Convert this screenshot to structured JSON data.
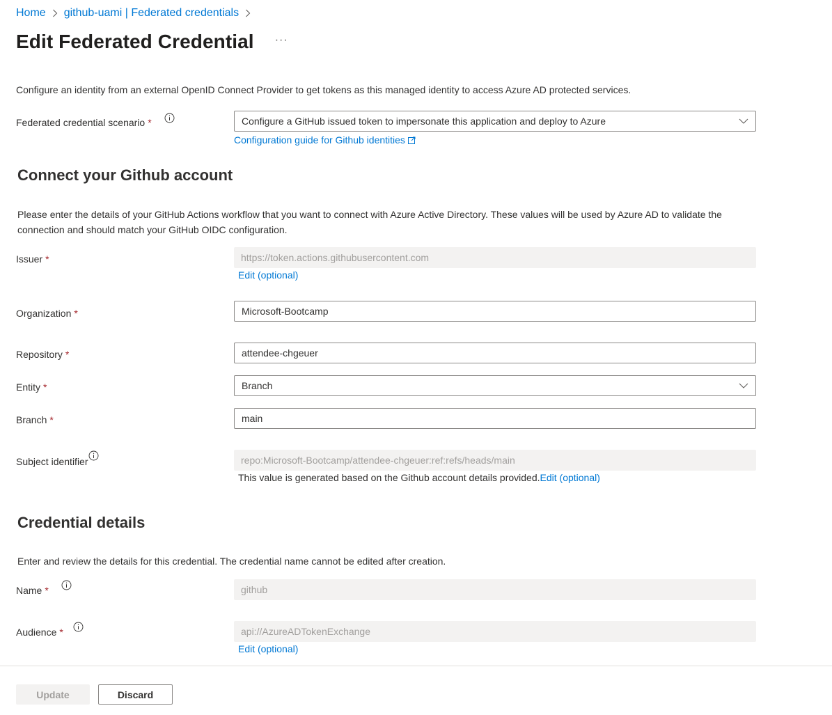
{
  "breadcrumb": {
    "items": [
      {
        "label": "Home"
      },
      {
        "label": "github-uami | Federated credentials"
      }
    ]
  },
  "header": {
    "title": "Edit Federated Credential",
    "more_label": "···"
  },
  "intro": "Configure an identity from an external OpenID Connect Provider to get tokens as this managed identity to access Azure AD protected services.",
  "scenario": {
    "label": "Federated credential scenario",
    "required": "*",
    "value": "Configure a GitHub issued token to impersonate this application and deploy to Azure",
    "guide_link": "Configuration guide for Github identities"
  },
  "github_section": {
    "title": "Connect your Github account",
    "description": "Please enter the details of your GitHub Actions workflow that you want to connect with Azure Active Directory. These values will be used by Azure AD to validate the connection and should match your GitHub OIDC configuration.",
    "issuer": {
      "label": "Issuer",
      "required": "*",
      "value": "https://token.actions.githubusercontent.com",
      "edit_link": "Edit (optional)"
    },
    "organization": {
      "label": "Organization",
      "required": "*",
      "value": "Microsoft-Bootcamp"
    },
    "repository": {
      "label": "Repository",
      "required": "*",
      "value": "attendee-chgeuer"
    },
    "entity": {
      "label": "Entity",
      "required": "*",
      "value": "Branch"
    },
    "branch": {
      "label": "Branch",
      "required": "*",
      "value": "main"
    },
    "subject": {
      "label": "Subject identifier",
      "value": "repo:Microsoft-Bootcamp/attendee-chgeuer:ref:refs/heads/main",
      "helper": "This value is generated based on the Github account details provided.",
      "edit_link": "Edit (optional)"
    }
  },
  "credential_section": {
    "title": "Credential details",
    "description": "Enter and review the details for this credential. The credential name cannot be edited after creation.",
    "name": {
      "label": "Name",
      "required": "*",
      "value": "github"
    },
    "audience": {
      "label": "Audience",
      "required": "*",
      "value": "api://AzureADTokenExchange",
      "edit_link": "Edit (optional)"
    }
  },
  "footer": {
    "update_label": "Update",
    "discard_label": "Discard"
  },
  "colors": {
    "accent": "#0078d4",
    "required": "#a4262c",
    "disabled_bg": "#f3f2f1",
    "disabled_text": "#a19f9d"
  }
}
